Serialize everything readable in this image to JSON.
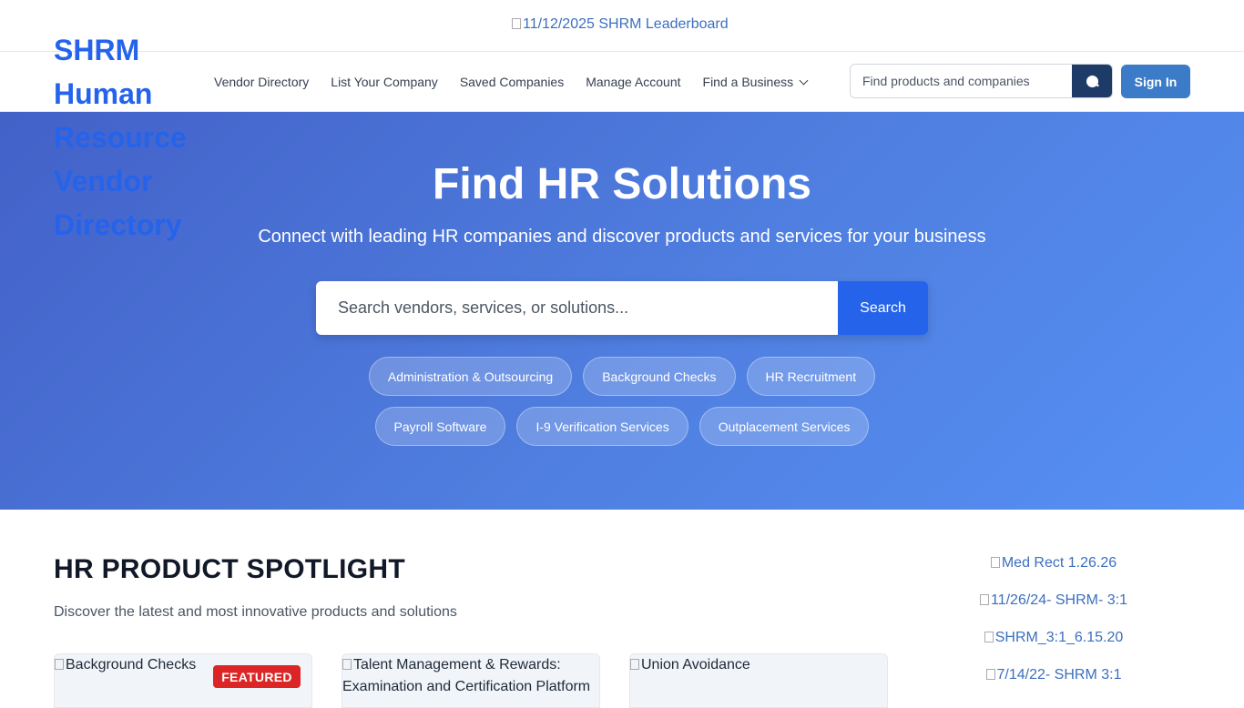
{
  "banner": {
    "leaderboard_alt": "11/12/2025 SHRM Leaderboard"
  },
  "nav": {
    "logo_lines": [
      "SHRM",
      "Human",
      "Resource",
      "Vendor",
      "Directory"
    ],
    "links": [
      "Vendor Directory",
      "List Your Company",
      "Saved Companies",
      "Manage Account",
      "Find a Business"
    ],
    "search_placeholder": "Find products and companies",
    "signin_label": "Sign In"
  },
  "hero": {
    "title": "Find HR Solutions",
    "subtitle": "Connect with leading HR companies and discover products and services for your business",
    "search_placeholder": "Search vendors, services, or solutions...",
    "search_button": "Search",
    "chips_row1": [
      "Administration & Outsourcing",
      "Background Checks",
      "HR Recruitment"
    ],
    "chips_row2": [
      "Payroll Software",
      "I-9 Verification Services",
      "Outplacement Services"
    ]
  },
  "spotlight": {
    "title": "HR PRODUCT SPOTLIGHT",
    "subtitle": "Discover the latest and most innovative products and solutions",
    "cards": [
      {
        "alt": "Background Checks",
        "badge": "FEATURED"
      },
      {
        "alt": "Talent Management & Rewards: Examination and Certification Platform"
      },
      {
        "alt": "Union Avoidance"
      }
    ]
  },
  "sidebar_ads": [
    "Med Rect 1.26.26",
    "11/26/24- SHRM- 3:1",
    "SHRM_3:1_6.15.20",
    "7/14/22- SHRM 3:1"
  ],
  "colors": {
    "brand_blue": "#2563eb",
    "nav_search_btn": "#1e3a66",
    "signin": "#3b7bc8",
    "featured_badge": "#dc2626"
  }
}
